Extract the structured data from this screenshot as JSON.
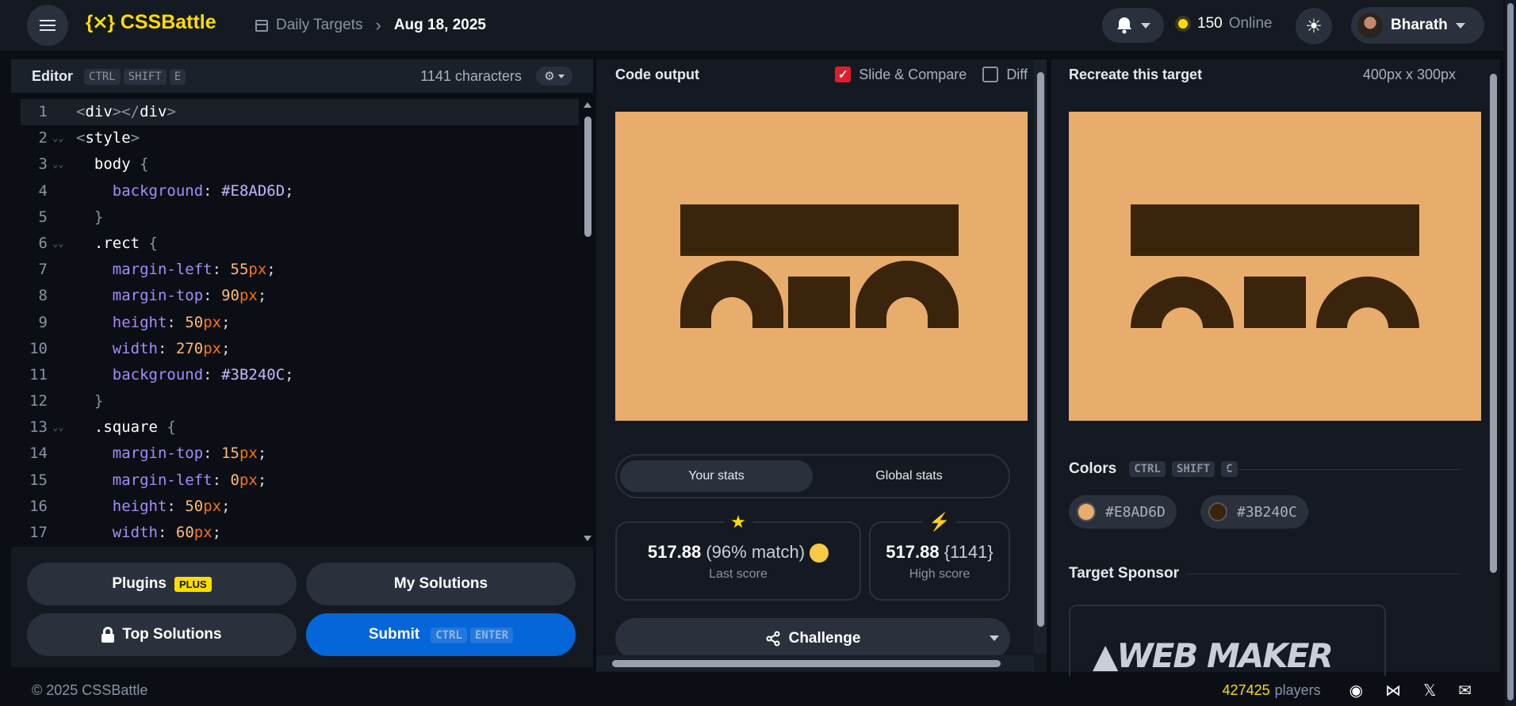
{
  "topbar": {
    "logo_mark": "{⨯}",
    "logo_text": "CSSBattle",
    "breadcrumb_parent": "Daily Targets",
    "breadcrumb_current": "Aug 18, 2025",
    "online_count": "150",
    "online_label": "Online",
    "user_name": "Bharath"
  },
  "editor": {
    "title": "Editor",
    "shortcut": [
      "CTRL",
      "SHIFT",
      "E"
    ],
    "char_count": "1141 characters",
    "lines": [
      {
        "n": "1",
        "text": "<div></div>"
      },
      {
        "n": "2",
        "text": "<style>"
      },
      {
        "n": "3",
        "text": "  body {"
      },
      {
        "n": "4",
        "text": "    background: #E8AD6D;"
      },
      {
        "n": "5",
        "text": "  }"
      },
      {
        "n": "6",
        "text": "  .rect {"
      },
      {
        "n": "7",
        "text": "    margin-left: 55px;"
      },
      {
        "n": "8",
        "text": "    margin-top: 90px;"
      },
      {
        "n": "9",
        "text": "    height: 50px;"
      },
      {
        "n": "10",
        "text": "    width: 270px;"
      },
      {
        "n": "11",
        "text": "    background: #3B240C;"
      },
      {
        "n": "12",
        "text": "  }"
      },
      {
        "n": "13",
        "text": "  .square {"
      },
      {
        "n": "14",
        "text": "    margin-top: 15px;"
      },
      {
        "n": "15",
        "text": "    margin-left: 0px;"
      },
      {
        "n": "16",
        "text": "    height: 50px;"
      },
      {
        "n": "17",
        "text": "    width: 60px;"
      }
    ],
    "plugins_label": "Plugins",
    "plugins_badge": "PLUS",
    "my_solutions_label": "My Solutions",
    "top_solutions_label": "Top Solutions",
    "submit_label": "Submit",
    "submit_shortcut": [
      "CTRL",
      "ENTER"
    ]
  },
  "output": {
    "title": "Code output",
    "slide_compare_label": "Slide & Compare",
    "slide_compare_checked": true,
    "diff_label": "Diff",
    "diff_checked": false,
    "tab_your_stats": "Your stats",
    "tab_global_stats": "Global stats",
    "last_score_value": "517.88",
    "last_score_match": "(96% match)",
    "last_score_label": "Last score",
    "high_score_value": "517.88",
    "high_score_chars": "{1141}",
    "high_score_label": "High score",
    "challenge_label": "Challenge"
  },
  "target": {
    "title": "Recreate this target",
    "dims": "400px x 300px",
    "colors_title": "Colors",
    "colors_shortcut": [
      "CTRL",
      "SHIFT",
      "C"
    ],
    "colors": [
      {
        "hex": "#E8AD6D"
      },
      {
        "hex": "#3B240C"
      }
    ],
    "sponsor_title": "Target Sponsor",
    "sponsor_logo_text": "WEB MAKER"
  },
  "footer": {
    "copyright": "© 2025 CSSBattle",
    "players_count": "427425",
    "players_label": "players"
  },
  "palette": {
    "accent_yellow": "#ffdd00",
    "submit_blue": "#0566d9",
    "canvas_bg": "#E8AD6D",
    "shape_color": "#3B240C"
  },
  "icons": [
    "hamburger-icon",
    "calendar-icon",
    "chevron-right-icon",
    "bell-icon",
    "sun-icon",
    "gear-icon",
    "lock-icon",
    "star-icon",
    "bolt-icon",
    "share-icon",
    "discord-icon",
    "bluesky-icon",
    "x-icon",
    "mail-icon"
  ]
}
